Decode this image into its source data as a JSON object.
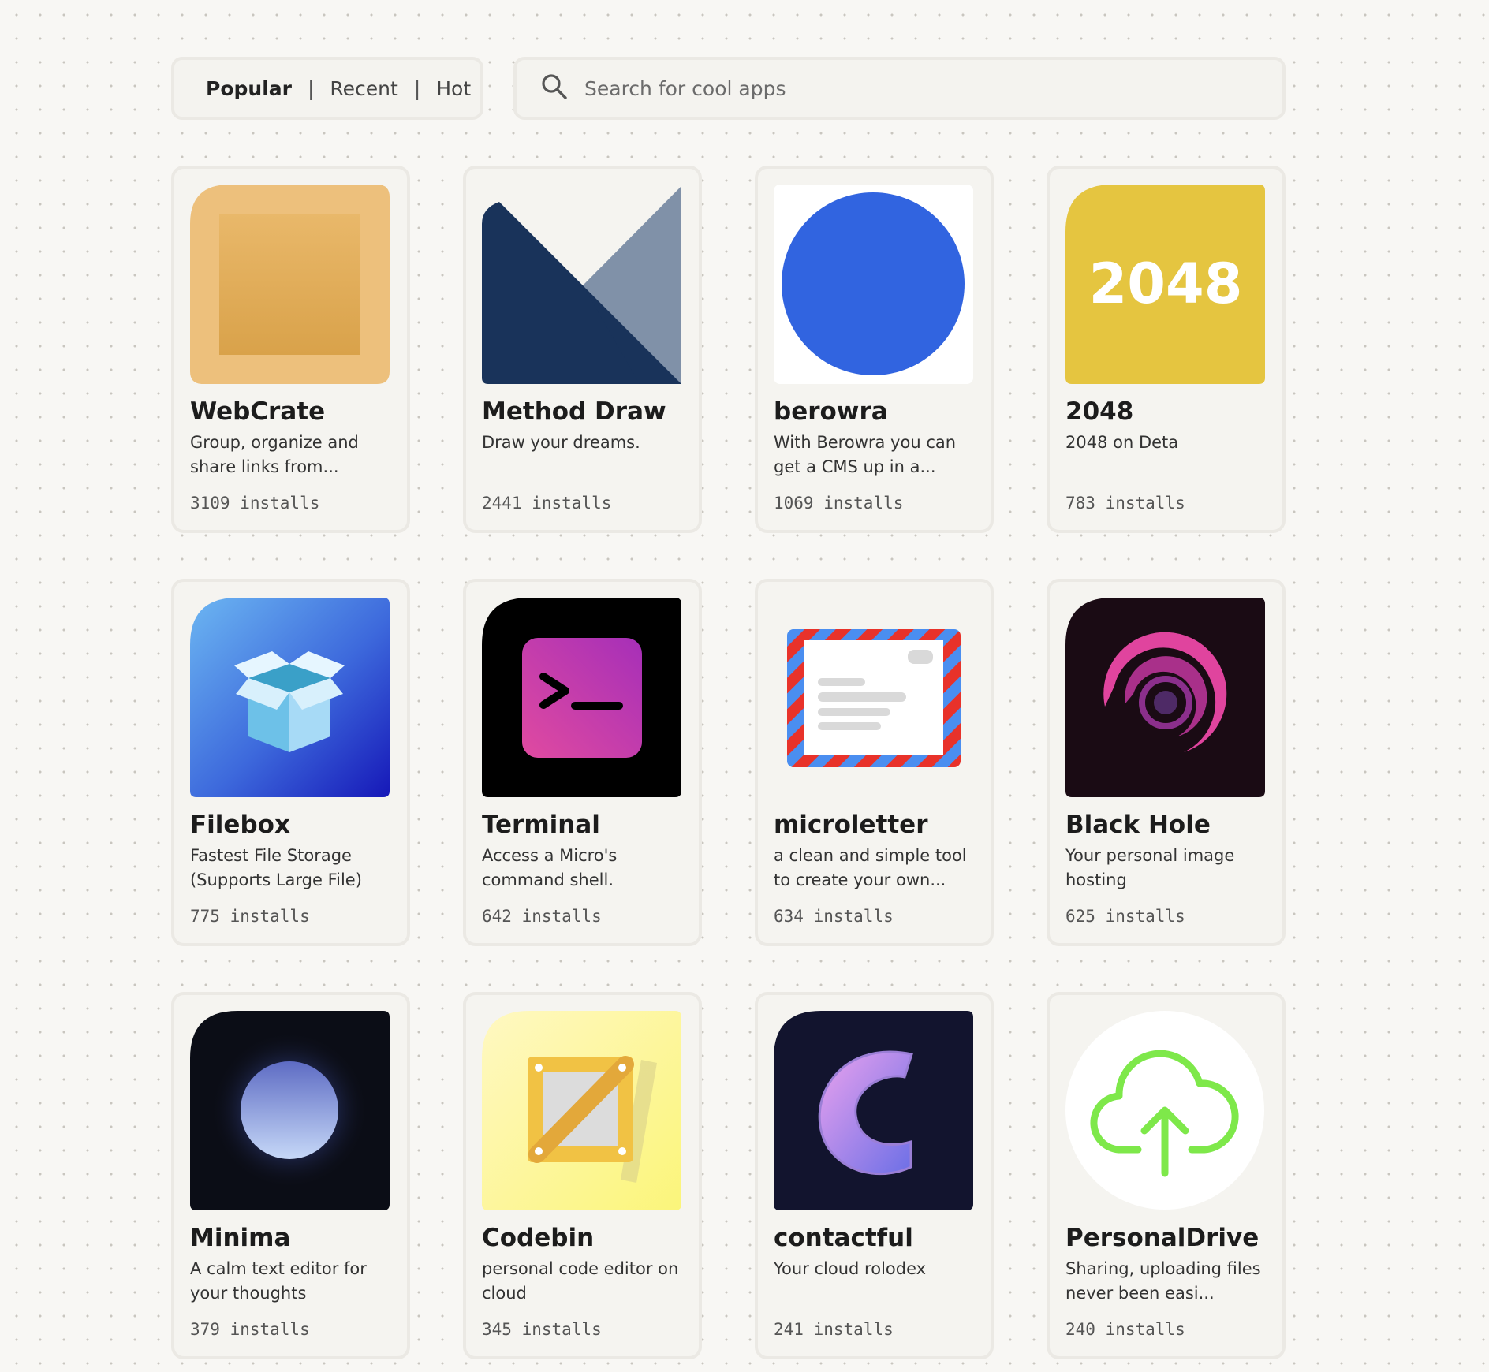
{
  "filters": {
    "tabs": [
      "Popular",
      "Recent",
      "Hot"
    ],
    "separator": "|",
    "active": "Popular"
  },
  "search": {
    "placeholder": "Search for cool apps",
    "value": ""
  },
  "apps": [
    {
      "name": "WebCrate",
      "description": "Group, organize and share links from...",
      "installs": "3109 installs",
      "icon": "webcrate-icon"
    },
    {
      "name": "Method Draw",
      "description": "Draw your dreams.",
      "installs": "2441 installs",
      "icon": "method-draw-icon"
    },
    {
      "name": "berowra",
      "description": "With Berowra you can get a CMS up in a...",
      "installs": "1069 installs",
      "icon": "berowra-icon"
    },
    {
      "name": "2048",
      "description": "2048 on Deta",
      "installs": "783 installs",
      "icon": "2048-icon",
      "icon_text": "2048"
    },
    {
      "name": "Filebox",
      "description": "Fastest File Storage (Supports Large File)",
      "installs": "775 installs",
      "icon": "filebox-icon"
    },
    {
      "name": "Terminal",
      "description": "Access a Micro's command shell.",
      "installs": "642 installs",
      "icon": "terminal-icon"
    },
    {
      "name": "microletter",
      "description": "a clean and simple tool to create your own...",
      "installs": "634 installs",
      "icon": "microletter-icon"
    },
    {
      "name": "Black Hole",
      "description": "Your personal image hosting",
      "installs": "625 installs",
      "icon": "black-hole-icon"
    },
    {
      "name": "Minima",
      "description": "A calm text editor for your thoughts",
      "installs": "379 installs",
      "icon": "minima-icon"
    },
    {
      "name": "Codebin",
      "description": "personal code editor on cloud",
      "installs": "345 installs",
      "icon": "codebin-icon"
    },
    {
      "name": "contactful",
      "description": "Your cloud rolodex",
      "installs": "241 installs",
      "icon": "contactful-icon"
    },
    {
      "name": "PersonalDrive",
      "description": "Sharing, uploading files never been easi...",
      "installs": "240 installs",
      "icon": "personal-drive-icon"
    }
  ],
  "colors": {
    "background": "#f8f7f4",
    "card": "#f5f4f0",
    "card_border": "#ebe9e4"
  }
}
